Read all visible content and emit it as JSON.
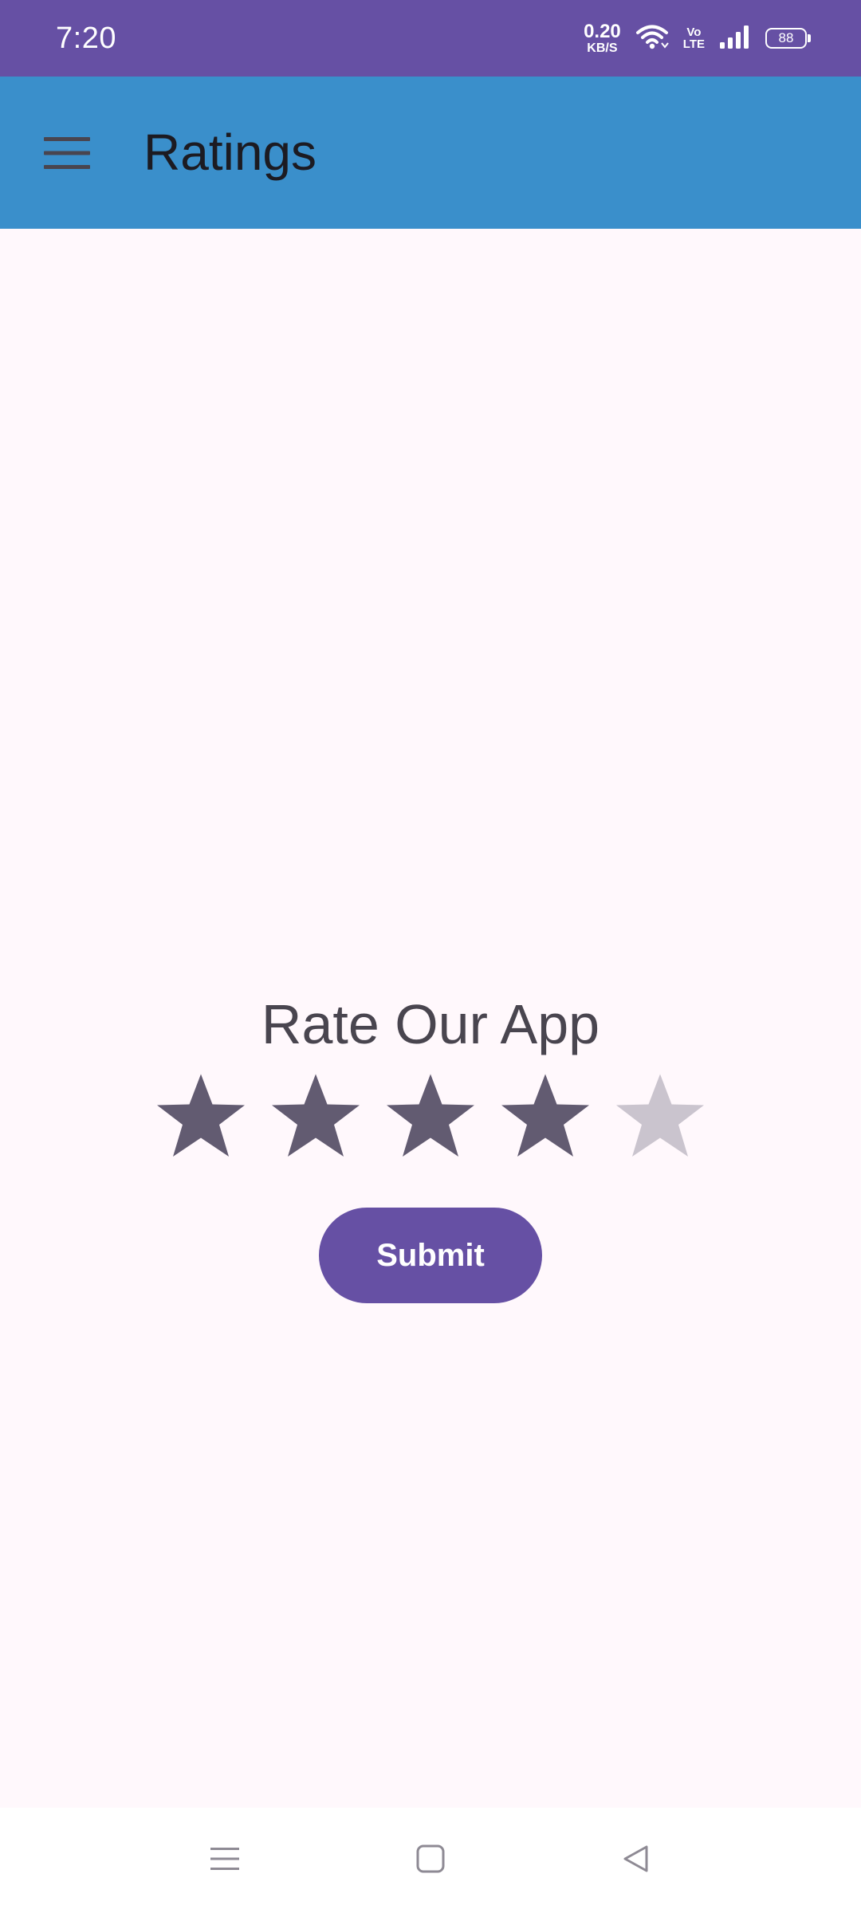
{
  "status_bar": {
    "time": "7:20",
    "net_speed_value": "0.20",
    "net_speed_unit": "KB/S",
    "volte_top": "Vo",
    "volte_bottom": "LTE",
    "battery_level": "88",
    "background_color": "#6650A4"
  },
  "app_bar": {
    "menu_icon": "hamburger-menu-icon",
    "title": "Ratings",
    "background_color": "#3A8FCB"
  },
  "rating": {
    "title": "Rate Our App",
    "value": 4,
    "max": 5,
    "filled_color": "#625B71",
    "empty_color": "#CAC4CE"
  },
  "submit": {
    "label": "Submit",
    "color": "#6650A4"
  },
  "nav_bar": {
    "recents_icon": "recents-icon",
    "home_icon": "home-icon",
    "back_icon": "back-icon"
  }
}
